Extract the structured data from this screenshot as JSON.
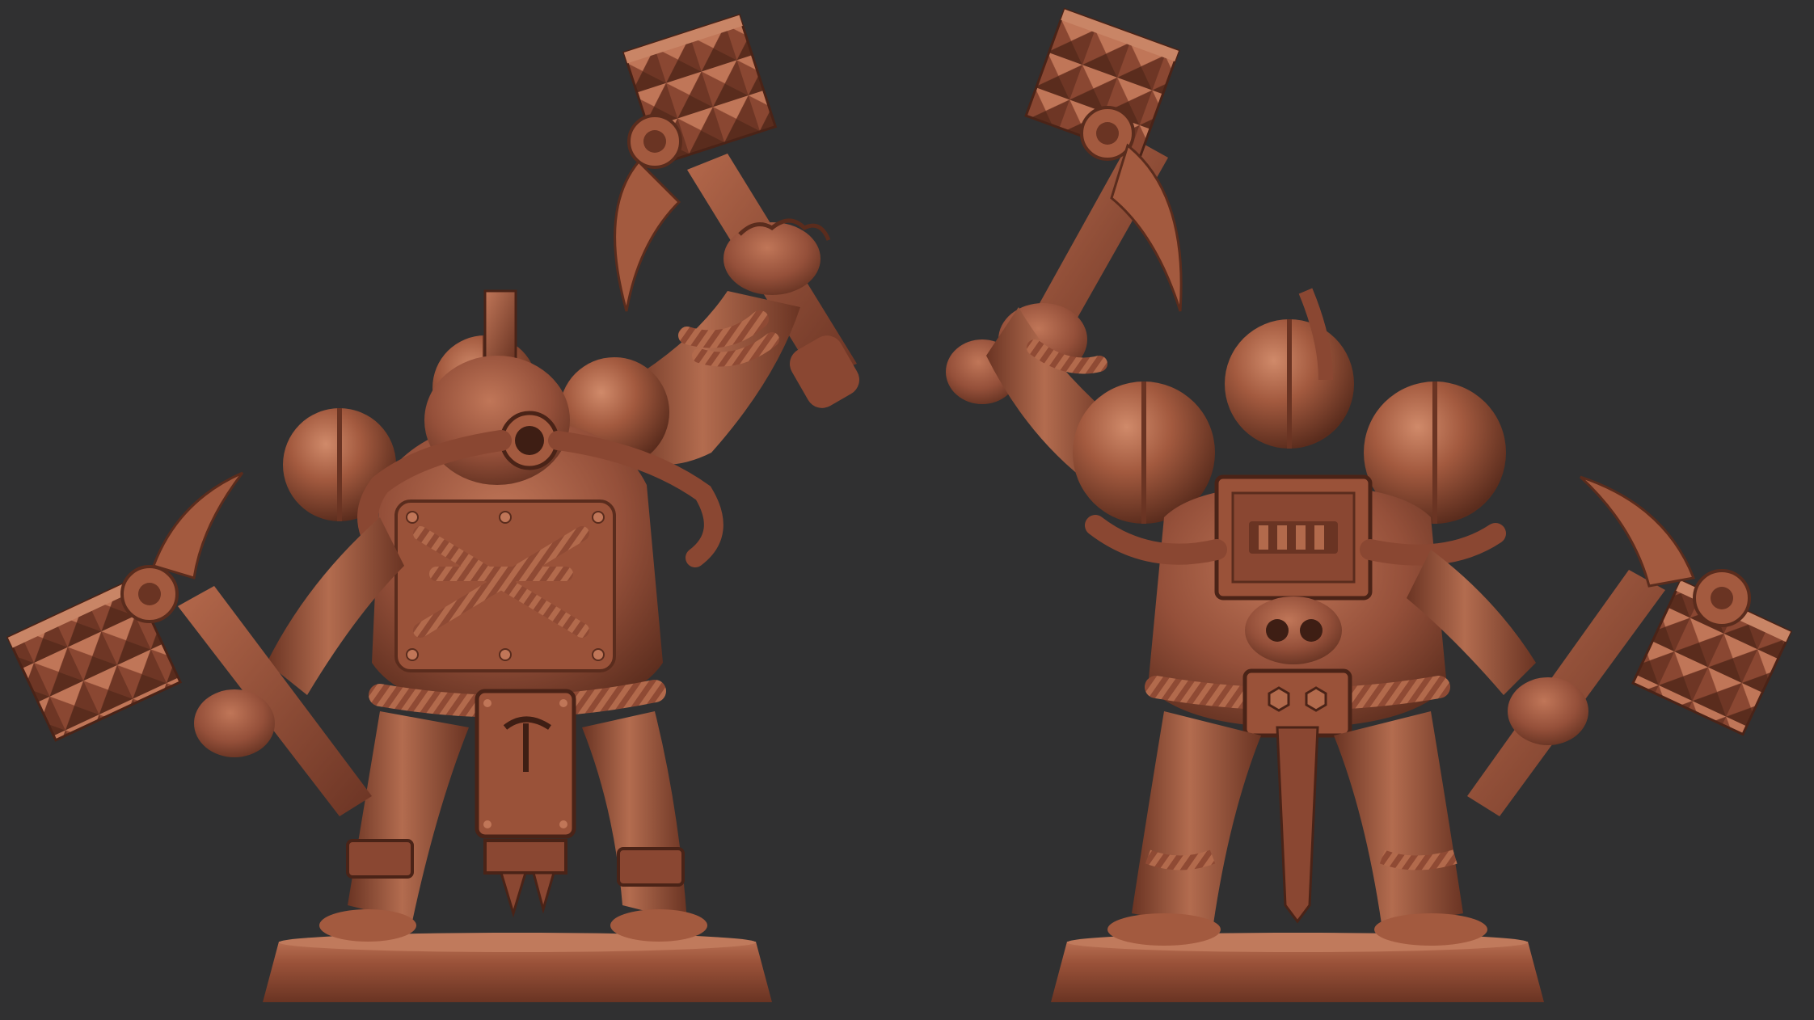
{
  "scene": {
    "background": "#303031",
    "palette": {
      "clay_base": "#9a5239",
      "clay_light": "#c47a5c",
      "clay_shadow": "#5e2e1f",
      "clay_dark": "#3e1e14"
    },
    "views": [
      "front-view",
      "back-view"
    ]
  }
}
